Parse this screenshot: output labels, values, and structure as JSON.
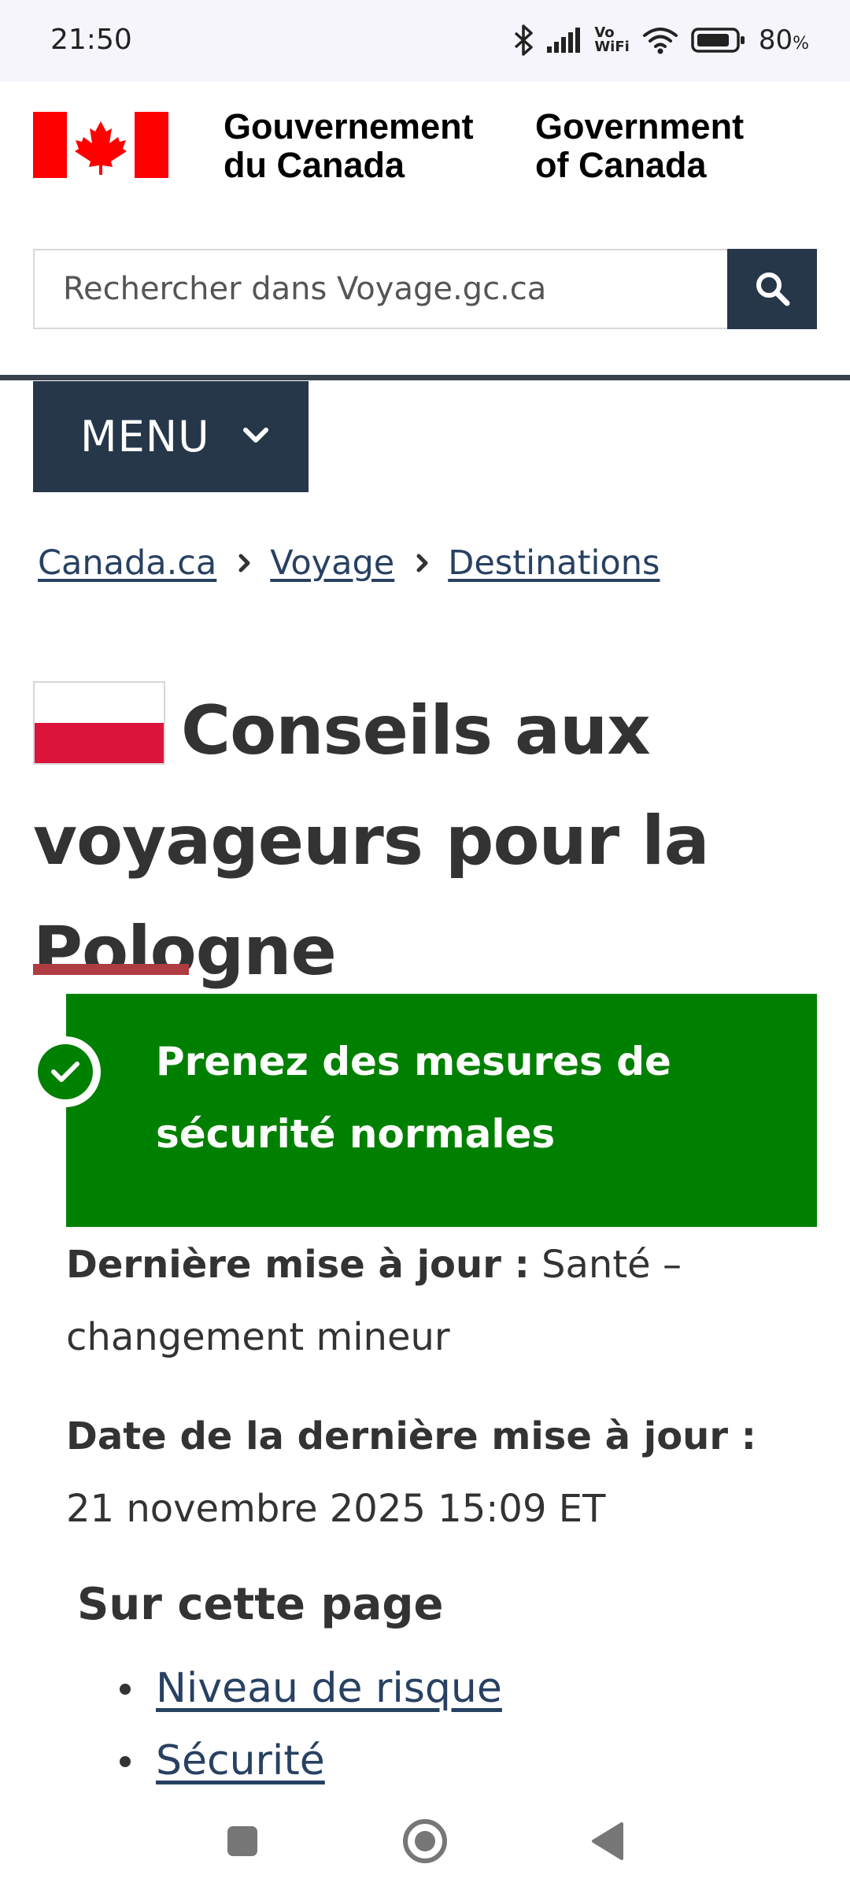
{
  "status_bar": {
    "time": "21:50",
    "battery_percent": "80",
    "battery_unit": "%",
    "vowifi_top": "Vo",
    "vowifi_bottom": "WiFi",
    "icons": [
      "bluetooth-icon",
      "cellular-signal-icon",
      "vowifi-icon",
      "wifi-icon",
      "battery-icon"
    ]
  },
  "header": {
    "signature_fr_line1": "Gouvernement",
    "signature_fr_line2": "du Canada",
    "signature_en_line1": "Government",
    "signature_en_line2": "of Canada",
    "flag_red": "#ff0000"
  },
  "search": {
    "placeholder": "Rechercher dans Voyage.gc.ca",
    "value": "",
    "button_icon": "search-icon",
    "button_color": "#26374a"
  },
  "menu": {
    "label": "MENU",
    "icon": "chevron-down-icon"
  },
  "breadcrumb": [
    {
      "label": "Canada.ca"
    },
    {
      "label": "Voyage"
    },
    {
      "label": "Destinations"
    }
  ],
  "page": {
    "title": "Conseils aux voyageurs pour la Pologne",
    "flag_icon": "poland-flag-icon",
    "underline_color": "#af3c43"
  },
  "risk": {
    "text_line1": "Prenez des mesures de",
    "text_line2": "sécurité normales",
    "color": "#008000",
    "icon": "checkmark-icon"
  },
  "update": {
    "last_update_label": "Dernière mise à jour :",
    "last_update_value": "Santé – changement mineur",
    "date_label": "Date de la dernière mise à jour :",
    "date_value": "21 novembre 2025 15:09 ET"
  },
  "toc": {
    "heading": "Sur cette page",
    "items": [
      {
        "label": "Niveau de risque"
      },
      {
        "label": "Sécurité"
      }
    ]
  },
  "nav_bar": {
    "icons": [
      "recents-square-icon",
      "home-circle-icon",
      "back-triangle-icon"
    ]
  }
}
